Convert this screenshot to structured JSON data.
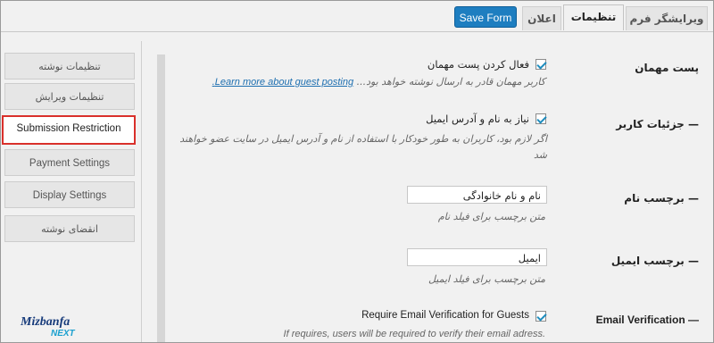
{
  "tabs": {
    "form_editor": "ویرایشگر فرم",
    "settings": "تنظیمات",
    "notifications": "اعلان"
  },
  "toolbar": {
    "save_label": "Save Form"
  },
  "menu": {
    "items": [
      "تنظیمات نوشته",
      "تنظیمات ویرایش",
      "Submission Restriction",
      "Payment Settings",
      "Display Settings",
      "انقضای نوشته"
    ],
    "active": "Submission Restriction"
  },
  "settings": {
    "guest_post": {
      "label": "پست مهمان",
      "checkbox_label": "فعال کردن پست مهمان",
      "description": "کاربر مهمان قادر به ارسال نوشته خواهد بود...",
      "link_text": "Learn more about guest posting.",
      "checked": true
    },
    "user_details": {
      "label": "— جزئیات کاربر",
      "checkbox_label": "نیاز به نام و آدرس ایمیل",
      "description": "اگر لازم بود، کاربران به طور خودکار با استفاده از نام و آدرس ایمیل در سایت عضو خواهند شد",
      "checked": true
    },
    "name_label": {
      "label": "— برچسب نام",
      "value": "نام و نام خانوادگی",
      "description": "متن برچسب برای فیلد نام"
    },
    "email_label": {
      "label": "— برچسب ایمیل",
      "value": "ایمیل",
      "description": "متن برچسب برای فیلد ایمیل"
    },
    "email_verification": {
      "label": "Email Verification —",
      "checkbox_label": "Require Email Verification for Guests",
      "description": "If requires, users will be required to verify their email adress.",
      "checked": true
    }
  },
  "logo": {
    "line1": "Mizbanfa",
    "line2": "NEXT"
  },
  "colors": {
    "accent": "#1e7ec0",
    "highlight_border": "#d9302b",
    "link": "#1e6fb0"
  }
}
